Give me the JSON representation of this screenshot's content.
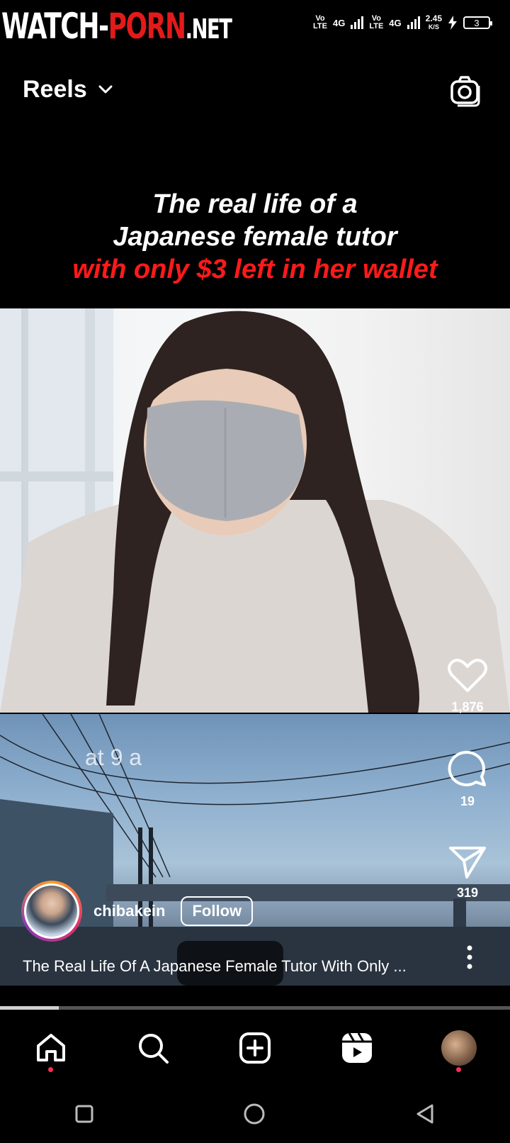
{
  "status_bar": {
    "watermark": {
      "part1": "WATCH-",
      "part2": "PORN",
      "part3": ".NET"
    },
    "network": [
      {
        "top": "Vo",
        "bottom": "LTE",
        "type": "4G"
      },
      {
        "top": "Vo",
        "bottom": "LTE",
        "type": "4G"
      }
    ],
    "speed": {
      "value": "2.45",
      "unit": "K/S"
    },
    "battery": "3",
    "icons": [
      "signal-icon",
      "charging-icon",
      "battery-icon"
    ]
  },
  "header": {
    "title": "Reels",
    "icons": [
      "chevron-down-icon",
      "camera-icon"
    ]
  },
  "video": {
    "caption_lines": [
      "The real life of a",
      "Japanese female tutor",
      "with only $3 left in her wallet"
    ],
    "scene_text": "at 9 a"
  },
  "actions": {
    "likes": "1,876",
    "comments": "19",
    "shares": "319",
    "icons": [
      "heart-icon",
      "comment-icon",
      "send-icon",
      "more-icon"
    ]
  },
  "author": {
    "username": "chibakein",
    "follow_label": "Follow"
  },
  "post_caption": "The Real Life Of A Japanese Female Tutor With Only ...",
  "progress": 0.115,
  "bottom_nav": {
    "items": [
      "home-icon",
      "search-icon",
      "create-icon",
      "reels-icon",
      "profile-avatar"
    ]
  },
  "system_nav": [
    "recents-icon",
    "home-circle-icon",
    "back-icon"
  ],
  "colors": {
    "accent_red": "#ff1a1a",
    "notification_dot": "#ff2d55",
    "background": "#000000"
  }
}
